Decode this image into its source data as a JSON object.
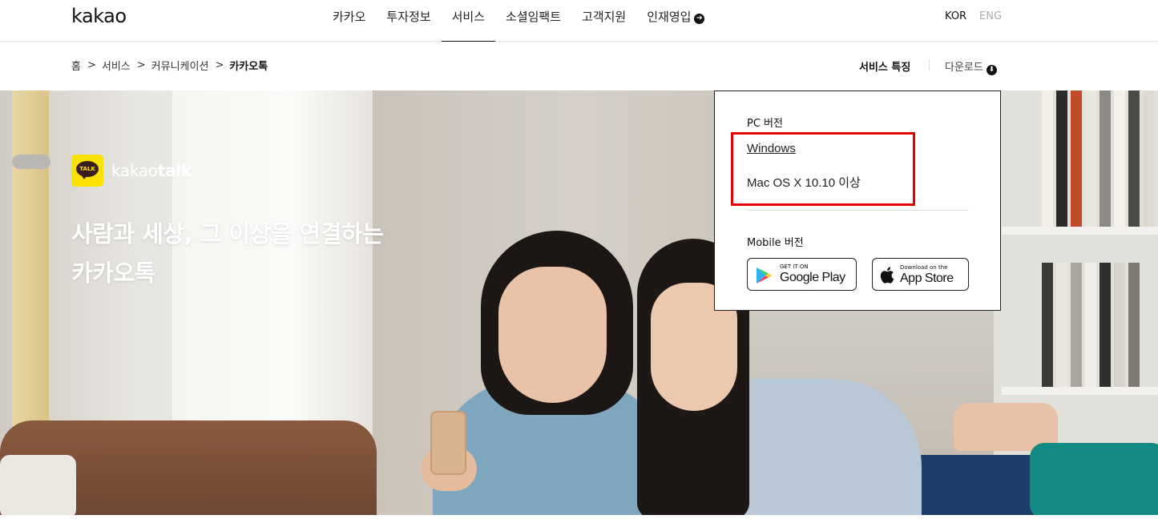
{
  "header": {
    "logo": "kakao",
    "nav": [
      "카카오",
      "투자정보",
      "서비스",
      "소셜임팩트",
      "고객지원",
      "인재영입"
    ],
    "active_nav": "서비스",
    "lang_kor": "KOR",
    "lang_eng": "ENG"
  },
  "breadcrumb": {
    "items": [
      "홈",
      "서비스",
      "커뮤니케이션",
      "카카오톡"
    ],
    "separator": ">"
  },
  "subnav": {
    "features": "서비스 특징",
    "download": "다운로드"
  },
  "hero": {
    "badge_text": "TALK",
    "brand_light": "kakao",
    "brand_bold": "talk",
    "headline_line1": "사람과 세상, 그 이상을 연결하는",
    "headline_line2": "카카오톡"
  },
  "download_panel": {
    "pc_title": "PC 버전",
    "windows": "Windows",
    "mac": "Mac OS X 10.10 이상",
    "mobile_title": "Mobile 버전",
    "google_play_small": "GET IT ON",
    "google_play_big": "Google Play",
    "app_store_small": "Download on the",
    "app_store_big": "App Store"
  },
  "colors": {
    "kakao_yellow": "#fae100",
    "highlight_red": "#e60000",
    "text_dark": "#111111"
  }
}
